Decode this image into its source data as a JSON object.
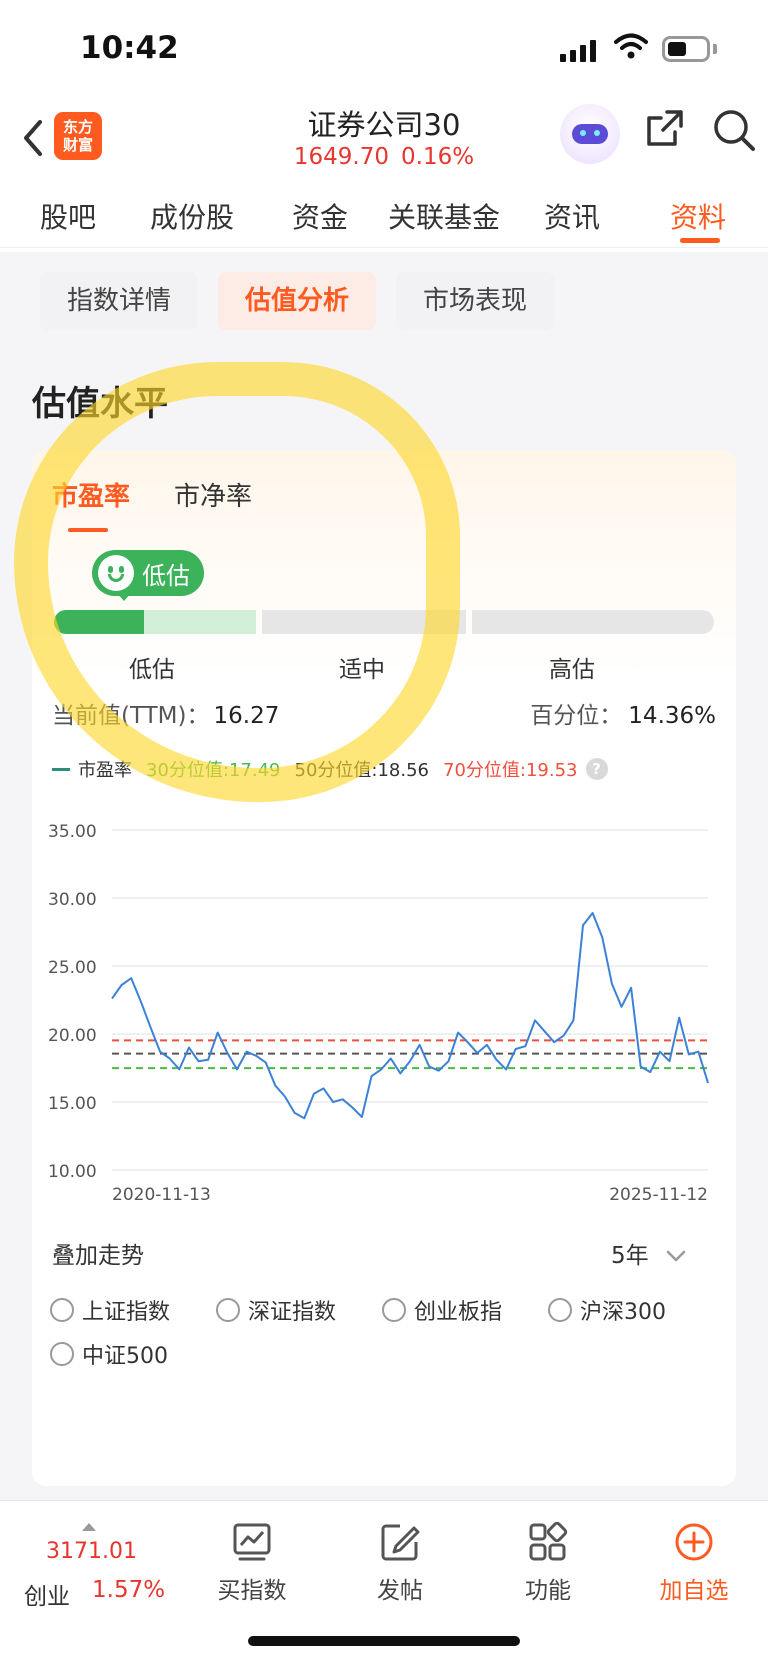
{
  "status": {
    "time": "10:42"
  },
  "header": {
    "logo_line1": "东方",
    "logo_line2": "财富",
    "title": "证券公司30",
    "price": "1649.70",
    "change": "0.16%"
  },
  "tabs": [
    {
      "label": "股吧"
    },
    {
      "label": "成份股"
    },
    {
      "label": "资金"
    },
    {
      "label": "关联基金"
    },
    {
      "label": "资讯"
    },
    {
      "label": "资料",
      "active": true
    }
  ],
  "chips": [
    {
      "label": "指数详情"
    },
    {
      "label": "估值分析",
      "active": true
    },
    {
      "label": "市场表现"
    }
  ],
  "section": {
    "title": "估值水平"
  },
  "valuation": {
    "sub_tabs": [
      {
        "label": "市盈率",
        "active": true
      },
      {
        "label": "市净率"
      }
    ],
    "badge": "低估",
    "gauge_labels": [
      "低估",
      "适中",
      "高估"
    ],
    "level_fraction": 0.144,
    "current_label": "当前值(TTM)：",
    "current_value": "16.27",
    "percentile_label": "百分位：",
    "percentile_value": "14.36%",
    "legend": {
      "series": "市盈率",
      "p30": "30分位值:17.49",
      "p50": "50分位值:18.56",
      "p70": "70分位值:19.53",
      "help": "?"
    },
    "colors": {
      "accent": "#ff5a1f",
      "low": "#3cb35a",
      "low_light": "#d2efd9",
      "line": "#3b82d6",
      "p30": "#4cb848",
      "p50": "#555555",
      "p70": "#ef4f3b"
    }
  },
  "chart_data": {
    "type": "line",
    "y_ticks": [
      "35.00",
      "30.00",
      "25.00",
      "20.00",
      "15.00",
      "10.00"
    ],
    "ylim": [
      10,
      35
    ],
    "x_labels": [
      "2020-11-13",
      "2025-11-12"
    ],
    "reference_lines": [
      {
        "name": "30分位值",
        "value": 17.49
      },
      {
        "name": "50分位值",
        "value": 18.56
      },
      {
        "name": "70分位值",
        "value": 19.53
      }
    ],
    "series": [
      {
        "name": "市盈率",
        "values": [
          22.6,
          23.6,
          24.1,
          22.4,
          20.5,
          18.7,
          18.2,
          17.4,
          19.0,
          18.0,
          18.1,
          20.1,
          18.6,
          17.4,
          18.7,
          18.4,
          17.9,
          16.2,
          15.4,
          14.2,
          13.8,
          15.6,
          16.0,
          15.0,
          15.2,
          14.6,
          13.9,
          16.9,
          17.4,
          18.2,
          17.1,
          18.0,
          19.2,
          17.6,
          17.3,
          18.0,
          20.1,
          19.4,
          18.6,
          19.2,
          18.1,
          17.4,
          18.9,
          19.1,
          21.0,
          20.2,
          19.4,
          19.9,
          21.0,
          28.0,
          28.9,
          27.1,
          23.7,
          22.0,
          23.4,
          17.6,
          17.2,
          18.7,
          18.0,
          21.2,
          18.5,
          18.7,
          16.4
        ]
      }
    ]
  },
  "overlay": {
    "label": "叠加走势",
    "period": "5年",
    "options": [
      "上证指数",
      "深证指数",
      "创业板指",
      "沪深300",
      "中证500"
    ]
  },
  "bottom": {
    "ticker_price": "3171.01",
    "ticker_name": "创业",
    "ticker_change": "1.57%",
    "items": [
      {
        "label": "买指数"
      },
      {
        "label": "发帖"
      },
      {
        "label": "功能"
      },
      {
        "label": "加自选"
      }
    ]
  }
}
